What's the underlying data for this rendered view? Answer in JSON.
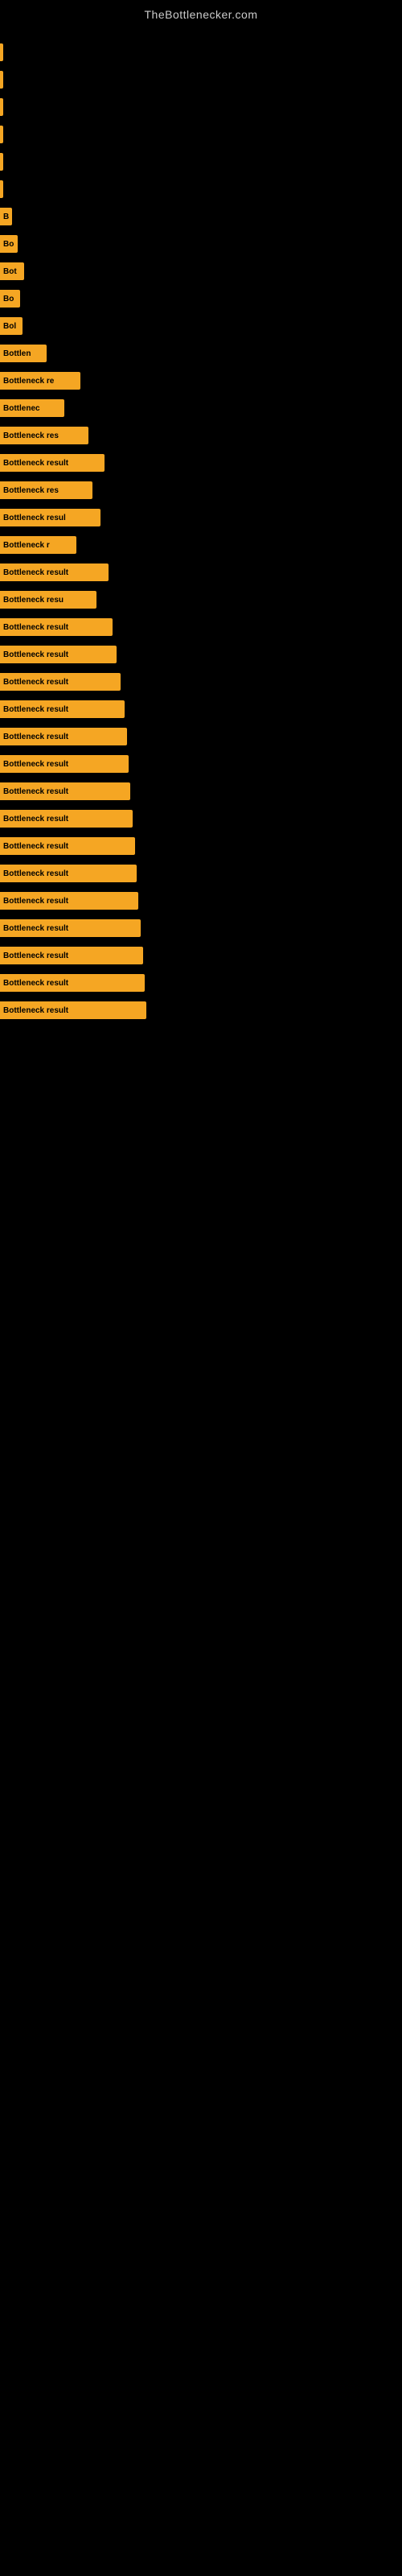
{
  "site": {
    "title": "TheBottlenecker.com"
  },
  "bars": [
    {
      "label": "",
      "width": 2
    },
    {
      "label": "",
      "width": 3
    },
    {
      "label": "",
      "width": 4
    },
    {
      "label": "",
      "width": 3
    },
    {
      "label": "",
      "width": 3
    },
    {
      "label": "",
      "width": 4
    },
    {
      "label": "B",
      "width": 15
    },
    {
      "label": "Bo",
      "width": 22
    },
    {
      "label": "Bot",
      "width": 30
    },
    {
      "label": "Bo",
      "width": 25
    },
    {
      "label": "Bol",
      "width": 28
    },
    {
      "label": "Bottlen",
      "width": 58
    },
    {
      "label": "Bottleneck re",
      "width": 100
    },
    {
      "label": "Bottlenec",
      "width": 80
    },
    {
      "label": "Bottleneck res",
      "width": 110
    },
    {
      "label": "Bottleneck result",
      "width": 130
    },
    {
      "label": "Bottleneck res",
      "width": 115
    },
    {
      "label": "Bottleneck resul",
      "width": 125
    },
    {
      "label": "Bottleneck r",
      "width": 95
    },
    {
      "label": "Bottleneck result",
      "width": 135
    },
    {
      "label": "Bottleneck resu",
      "width": 120
    },
    {
      "label": "Bottleneck result",
      "width": 140
    },
    {
      "label": "Bottleneck result",
      "width": 145
    },
    {
      "label": "Bottleneck result",
      "width": 150
    },
    {
      "label": "Bottleneck result",
      "width": 155
    },
    {
      "label": "Bottleneck result",
      "width": 158
    },
    {
      "label": "Bottleneck result",
      "width": 160
    },
    {
      "label": "Bottleneck result",
      "width": 162
    },
    {
      "label": "Bottleneck result",
      "width": 165
    },
    {
      "label": "Bottleneck result",
      "width": 168
    },
    {
      "label": "Bottleneck result",
      "width": 170
    },
    {
      "label": "Bottleneck result",
      "width": 172
    },
    {
      "label": "Bottleneck result",
      "width": 175
    },
    {
      "label": "Bottleneck result",
      "width": 178
    },
    {
      "label": "Bottleneck result",
      "width": 180
    },
    {
      "label": "Bottleneck result",
      "width": 182
    }
  ]
}
